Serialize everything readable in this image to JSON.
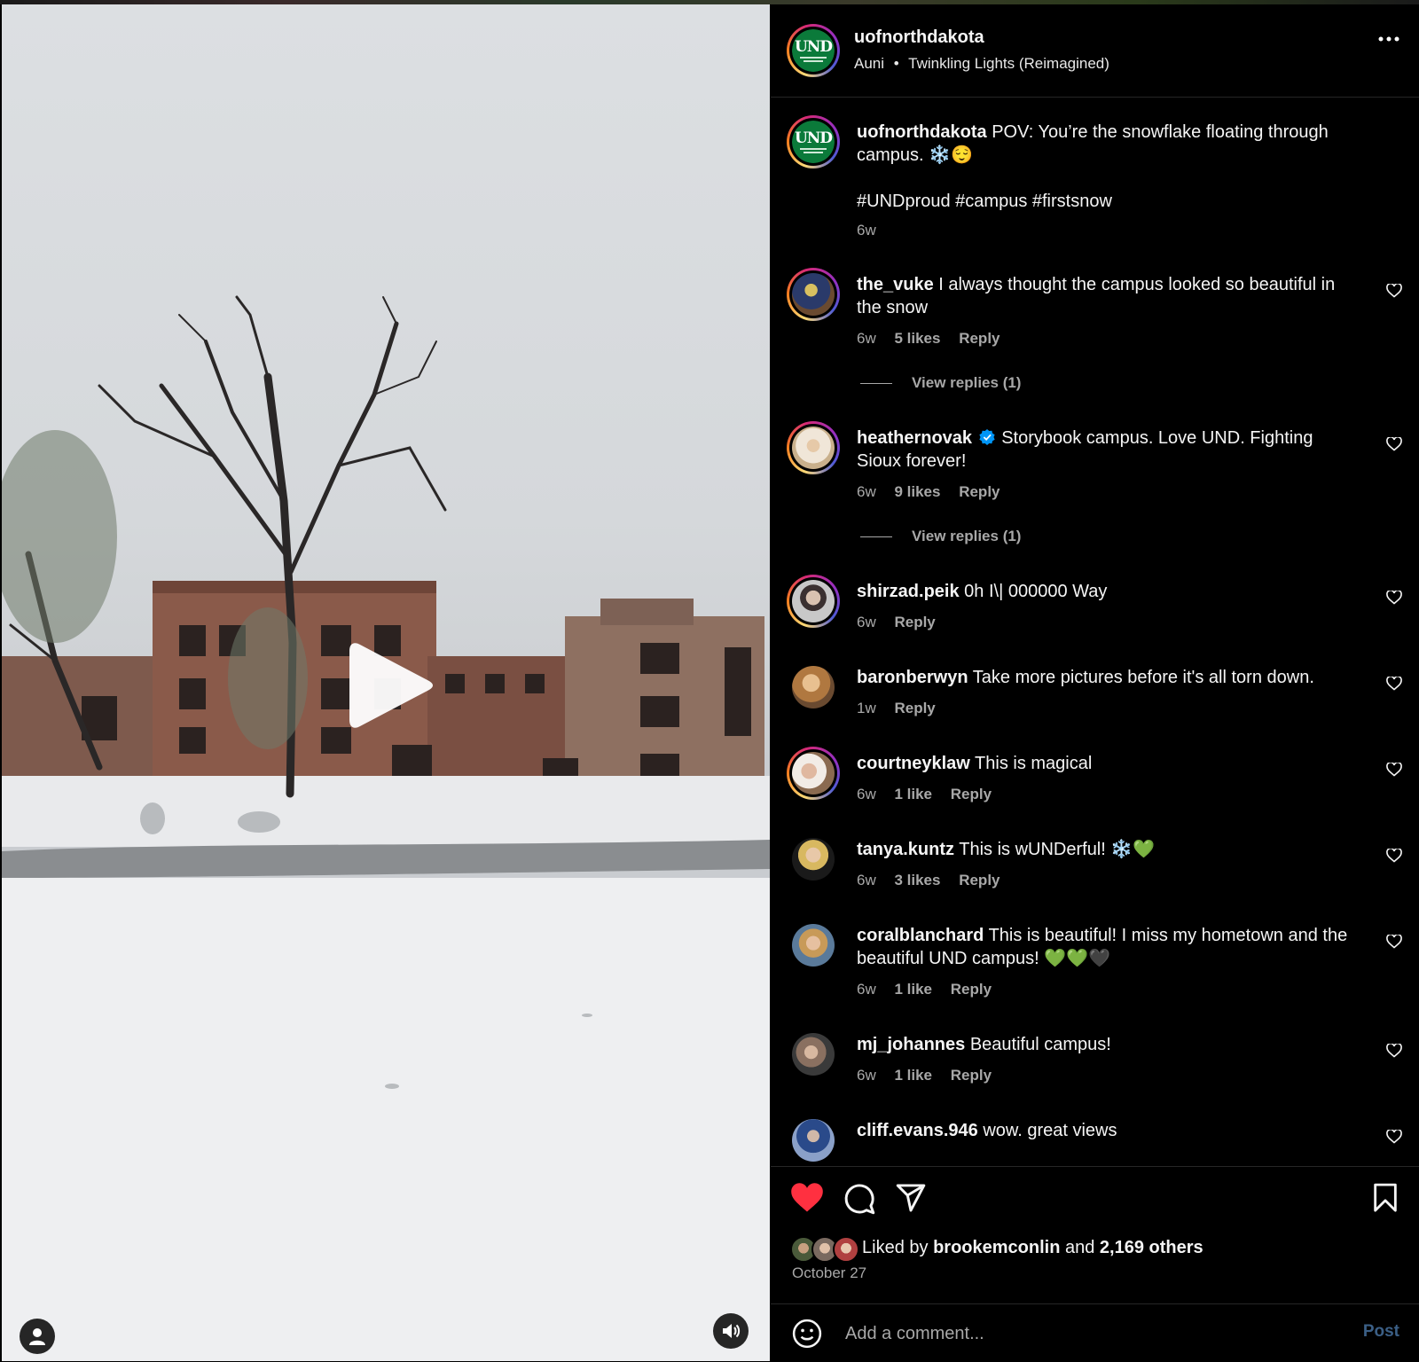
{
  "post": {
    "author": "uofnorthdakota",
    "artist": "Auni",
    "separator": "•",
    "song": "Twinkling Lights (Reimagined)"
  },
  "caption": {
    "username": "uofnorthdakota",
    "text": "POV: You’re the snowflake floating through campus. ❄️😌",
    "hashtags": "#UNDproud #campus #firstsnow",
    "time": "6w"
  },
  "comments": [
    {
      "username": "the_vuke",
      "text": "I always thought the campus looked so beautiful in the snow",
      "time": "6w",
      "likes": "5 likes",
      "reply": "Reply",
      "view_replies": "View replies (1)"
    },
    {
      "username": "heathernovak",
      "verified": true,
      "text": "Storybook campus. Love UND. Fighting Sioux forever!",
      "time": "6w",
      "likes": "9 likes",
      "reply": "Reply",
      "view_replies": "View replies (1)"
    },
    {
      "username": "shirzad.peik",
      "text": "0h I\\| 000000 Way",
      "time": "6w",
      "reply": "Reply"
    },
    {
      "username": "baronberwyn",
      "text": "Take more pictures before it's all torn down.",
      "time": "1w",
      "reply": "Reply"
    },
    {
      "username": "courtneyklaw",
      "text": "This is magical",
      "time": "6w",
      "likes": "1 like",
      "reply": "Reply"
    },
    {
      "username": "tanya.kuntz",
      "text": "This is wUNDerful! ❄️💚",
      "time": "6w",
      "likes": "3 likes",
      "reply": "Reply"
    },
    {
      "username": "coralblanchard",
      "text": "This is beautiful! I miss my hometown and the beautiful UND campus! 💚💚🖤",
      "time": "6w",
      "likes": "1 like",
      "reply": "Reply"
    },
    {
      "username": "mj_johannes",
      "text": "Beautiful campus!",
      "time": "6w",
      "likes": "1 like",
      "reply": "Reply"
    },
    {
      "username": "cliff.evans.946",
      "text": "wow. great views"
    }
  ],
  "likes": {
    "prefix": "Liked by",
    "user": "brookemconlin",
    "and": "and",
    "others": "2,169 others"
  },
  "date": "October 27",
  "comment_box": {
    "placeholder": "Add a comment...",
    "post_label": "Post"
  },
  "colors": {
    "like_red": "#ff3040",
    "verified_blue": "#0095f6",
    "und_green": "#0b7a3a",
    "post_disabled": "#3b5f86"
  },
  "icons": [
    "play-icon",
    "user-tag-icon",
    "sound-icon",
    "more-icon",
    "heart-icon",
    "comment-icon",
    "share-icon",
    "bookmark-icon",
    "emoji-icon",
    "verified-icon"
  ]
}
